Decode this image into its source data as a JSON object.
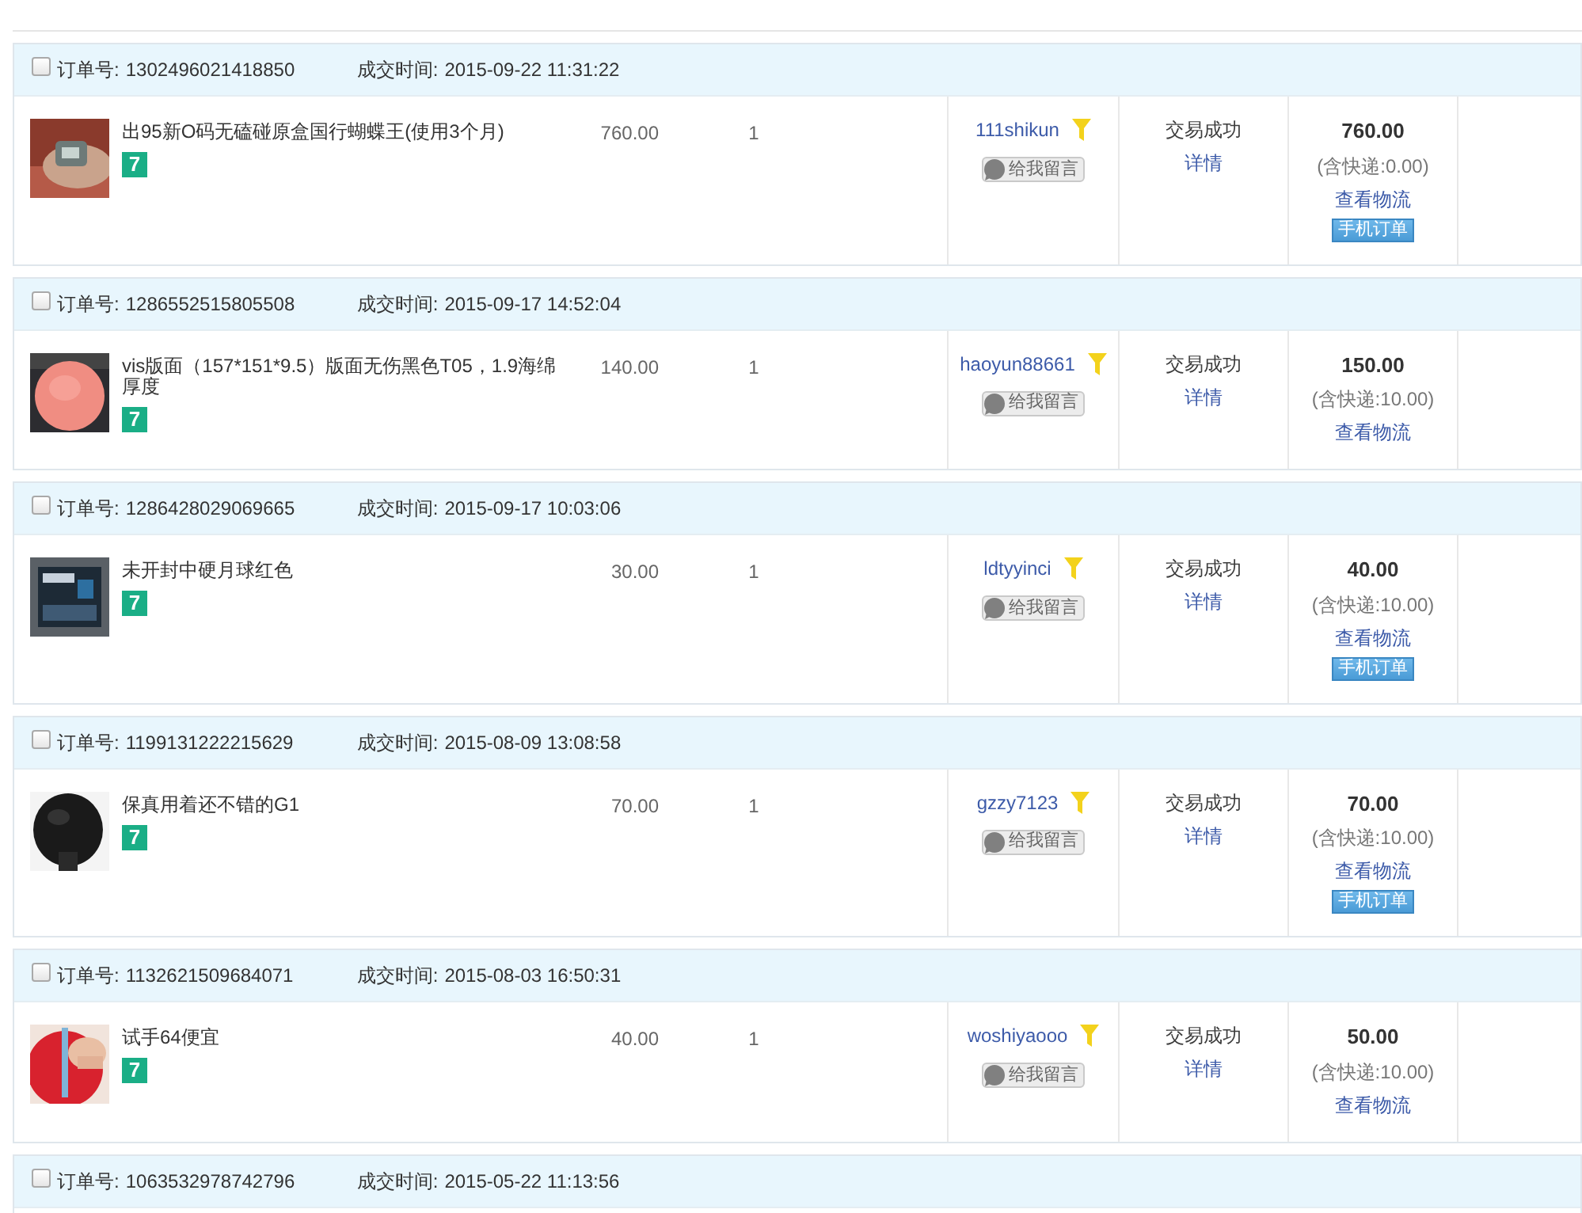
{
  "orders": [
    {
      "checked": false,
      "order_label": "订单号:",
      "order_no": "1302496021418850",
      "time_label": "成交时间:",
      "time": "2015-09-22 11:31:22",
      "title": "出95新O码无磕碰原盒国行蝴蝶王(使用3个月)",
      "badge": "7",
      "price": "760.00",
      "quantity": "1",
      "buyer": "111shikun",
      "message": "给我留言",
      "status": "交易成功",
      "detail": "详情",
      "amount": "760.00",
      "shipping": "(含快递:0.00)",
      "logistics": "查看物流",
      "mobile": "手机订单"
    },
    {
      "checked": false,
      "order_label": "订单号:",
      "order_no": "1286552515805508",
      "time_label": "成交时间:",
      "time": "2015-09-17 14:52:04",
      "title": "vis版面（157*151*9.5）版面无伤黑色T05，1.9海绵厚度",
      "badge": "7",
      "price": "140.00",
      "quantity": "1",
      "buyer": "haoyun88661",
      "message": "给我留言",
      "status": "交易成功",
      "detail": "详情",
      "amount": "150.00",
      "shipping": "(含快递:10.00)",
      "logistics": "查看物流"
    },
    {
      "checked": false,
      "order_label": "订单号:",
      "order_no": "1286428029069665",
      "time_label": "成交时间:",
      "time": "2015-09-17 10:03:06",
      "title": "未开封中硬月球红色",
      "badge": "7",
      "price": "30.00",
      "quantity": "1",
      "buyer": "ldtyyinci",
      "message": "给我留言",
      "status": "交易成功",
      "detail": "详情",
      "amount": "40.00",
      "shipping": "(含快递:10.00)",
      "logistics": "查看物流",
      "mobile": "手机订单"
    },
    {
      "checked": false,
      "order_label": "订单号:",
      "order_no": "1199131222215629",
      "time_label": "成交时间:",
      "time": "2015-08-09 13:08:58",
      "title": "保真用着还不错的G1",
      "badge": "7",
      "price": "70.00",
      "quantity": "1",
      "buyer": "gzzy7123",
      "message": "给我留言",
      "status": "交易成功",
      "detail": "详情",
      "amount": "70.00",
      "shipping": "(含快递:10.00)",
      "logistics": "查看物流",
      "mobile": "手机订单"
    },
    {
      "checked": false,
      "order_label": "订单号:",
      "order_no": "1132621509684071",
      "time_label": "成交时间:",
      "time": "2015-08-03 16:50:31",
      "title": "试手64便宜",
      "badge": "7",
      "price": "40.00",
      "quantity": "1",
      "buyer": "woshiyaooo",
      "message": "给我留言",
      "status": "交易成功",
      "detail": "详情",
      "amount": "50.00",
      "shipping": "(含快递:10.00)",
      "logistics": "查看物流"
    },
    {
      "checked": false,
      "order_label": "订单号:",
      "order_no": "1063532978742796",
      "time_label": "成交时间:",
      "time": "2015-05-22 11:13:56"
    }
  ]
}
